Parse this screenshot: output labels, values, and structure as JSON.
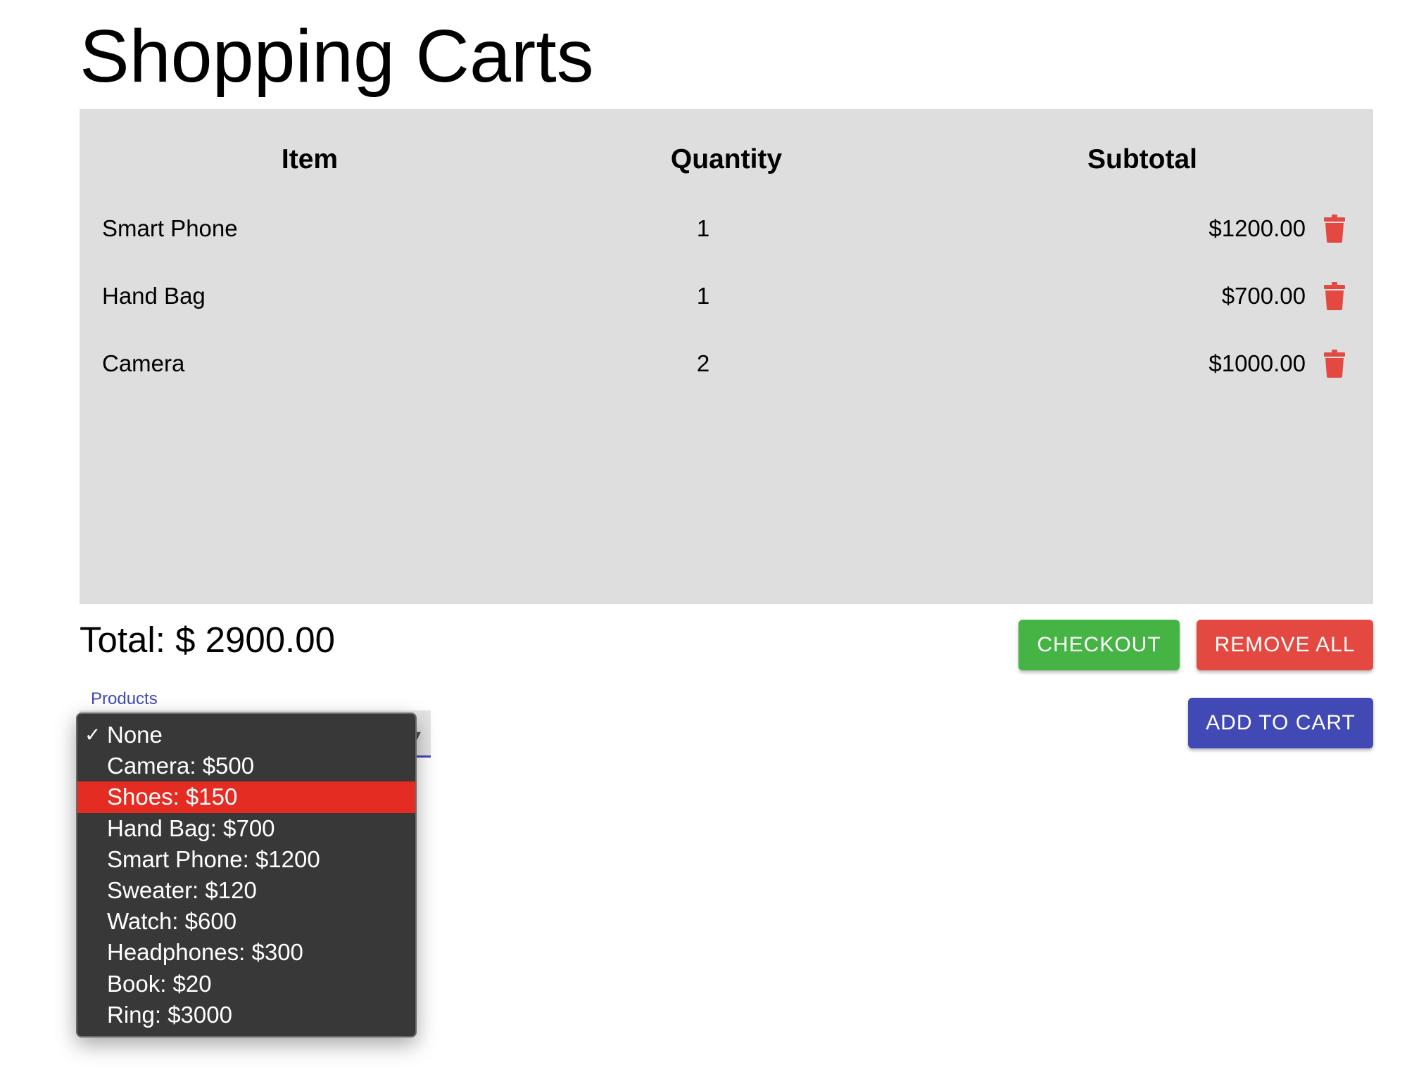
{
  "page": {
    "title": "Shopping Carts"
  },
  "cart": {
    "headers": {
      "item": "Item",
      "quantity": "Quantity",
      "subtotal": "Subtotal"
    },
    "rows": [
      {
        "item": "Smart Phone",
        "quantity": "1",
        "subtotal": "$1200.00",
        "delete_icon": "trash-icon"
      },
      {
        "item": "Hand Bag",
        "quantity": "1",
        "subtotal": "$700.00",
        "delete_icon": "trash-icon"
      },
      {
        "item": "Camera",
        "quantity": "2",
        "subtotal": "$1000.00",
        "delete_icon": "trash-icon"
      }
    ],
    "total_label": "Total: $ 2900.00"
  },
  "actions": {
    "checkout_label": "CHECKOUT",
    "remove_all_label": "REMOVE ALL",
    "add_to_cart_label": "ADD TO CART"
  },
  "products_select": {
    "label": "Products",
    "selected": "None",
    "highlighted": "Shoes: $150",
    "options": [
      "None",
      "Camera: $500",
      "Shoes: $150",
      "Hand Bag: $700",
      "Smart Phone: $1200",
      "Sweater: $120",
      "Watch: $600",
      "Headphones: $300",
      "Book: $20",
      "Ring: $3000"
    ],
    "check_mark": "✓"
  },
  "colors": {
    "panel_bg": "#dedede",
    "trash": "#e44941",
    "checkout": "#45b444",
    "remove_all": "#e44941",
    "add_to_cart": "#4149b4",
    "select_accent": "#3f49b5",
    "dropdown_bg": "#383838",
    "dropdown_highlight": "#e52c22"
  }
}
